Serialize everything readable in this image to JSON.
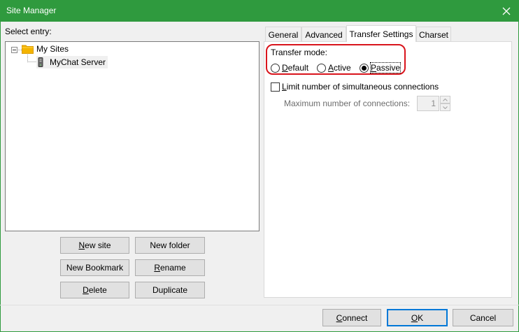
{
  "window": {
    "title": "Site Manager",
    "close_glyph": "✕"
  },
  "left": {
    "select_entry_label": "Select entry:",
    "tree": {
      "root": {
        "label": "My Sites",
        "expander": "−"
      },
      "child": {
        "label": "MyChat Server"
      }
    },
    "buttons": {
      "new_site": "New site",
      "new_folder": "New folder",
      "new_bookmark": "New Bookmark",
      "rename": "Rename",
      "delete": "Delete",
      "duplicate": "Duplicate"
    }
  },
  "tabs": [
    {
      "label": "General"
    },
    {
      "label": "Advanced"
    },
    {
      "label": "Transfer Settings"
    },
    {
      "label": "Charset"
    }
  ],
  "transfer": {
    "mode_label": "Transfer mode:",
    "options": [
      {
        "label": "Default",
        "selected": false
      },
      {
        "label": "Active",
        "selected": false
      },
      {
        "label": "Passive",
        "selected": true
      }
    ],
    "limit_label": "Limit number of simultaneous connections",
    "limit_checked": false,
    "max_label": "Maximum number of connections:",
    "max_value": "1"
  },
  "footer": {
    "connect": "Connect",
    "ok": "OK",
    "cancel": "Cancel"
  },
  "colors": {
    "titlebar": "#2f9a3e",
    "highlight": "#d9141c",
    "focus": "#0078d7",
    "folder": "#f4b400"
  }
}
